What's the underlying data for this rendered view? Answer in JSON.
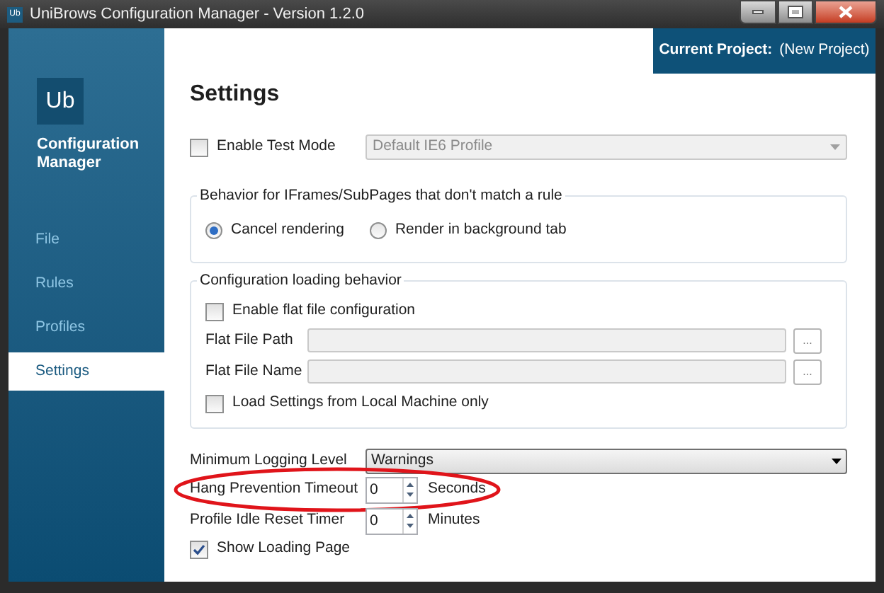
{
  "window": {
    "title": "UniBrows Configuration Manager - Version 1.2.0",
    "icon_text": "Ub"
  },
  "sidebar": {
    "logo_text": "Ub",
    "app_name": "Configuration Manager",
    "items": [
      {
        "label": "File",
        "selected": false
      },
      {
        "label": "Rules",
        "selected": false
      },
      {
        "label": "Profiles",
        "selected": false
      },
      {
        "label": "Settings",
        "selected": true
      }
    ]
  },
  "project": {
    "label": "Current Project:",
    "value": "(New Project)"
  },
  "heading": "Settings",
  "test_mode": {
    "label": "Enable Test Mode",
    "checked": false,
    "profile": {
      "value": "Default IE6 Profile",
      "disabled": true
    }
  },
  "iframe_group": {
    "legend": "Behavior for IFrames/SubPages that don't match a rule",
    "options": [
      {
        "label": "Cancel rendering",
        "selected": true
      },
      {
        "label": "Render in background tab",
        "selected": false
      }
    ]
  },
  "loading_group": {
    "legend": "Configuration loading behavior",
    "flat_file": {
      "label": "Enable flat file configuration",
      "checked": false
    },
    "fields": [
      {
        "label": "Flat File Path",
        "disabled": true,
        "browse": "..."
      },
      {
        "label": "Flat File Name",
        "disabled": true,
        "browse": "..."
      }
    ],
    "local_only": {
      "label": "Load Settings from Local Machine only",
      "checked": false
    }
  },
  "logging": {
    "label": "Minimum Logging Level",
    "value": "Warnings"
  },
  "spinners": [
    {
      "label": "Hang Prevention Timeout",
      "value": "0",
      "unit": "Seconds",
      "circled": true
    },
    {
      "label": "Profile Idle Reset Timer",
      "value": "0",
      "unit": "Minutes",
      "circled": false
    }
  ],
  "show_loading": {
    "label": "Show Loading Page",
    "checked": true
  }
}
